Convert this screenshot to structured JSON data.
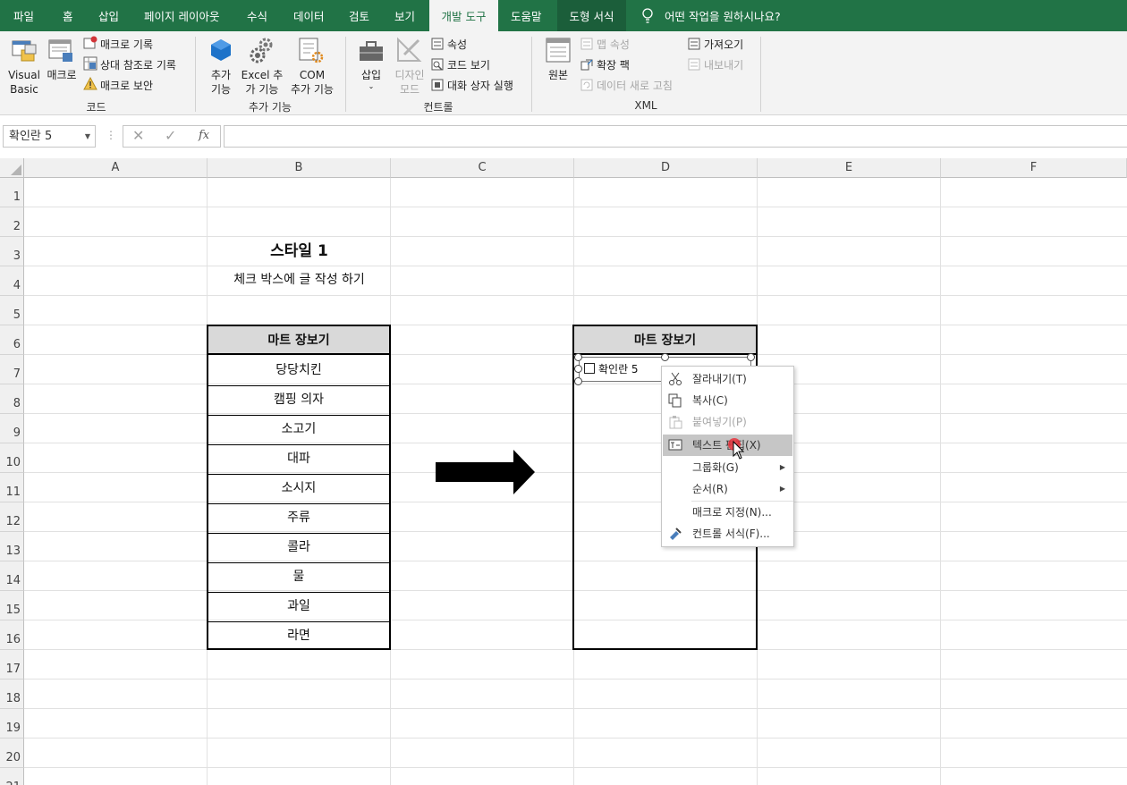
{
  "tabs": [
    "파일",
    "홈",
    "삽입",
    "페이지 레이아웃",
    "수식",
    "데이터",
    "검토",
    "보기",
    "개발 도구",
    "도움말",
    "도형 서식"
  ],
  "tell_me": "어떤 작업을 원하시나요?",
  "ribbon": {
    "code": {
      "visual_basic": [
        "Visual",
        "Basic"
      ],
      "macros": "매크로",
      "record_macro": "매크로 기록",
      "relative_ref": "상대 참조로 기록",
      "macro_security": "매크로 보안",
      "group_label": "코드"
    },
    "addins": {
      "addins": [
        "추가",
        "기능"
      ],
      "excel_addins": [
        "Excel 추",
        "가 기능"
      ],
      "com_addins": [
        "COM",
        "추가 기능"
      ],
      "group_label": "추가 기능"
    },
    "controls": {
      "insert": "삽입",
      "design_mode": [
        "디자인",
        "모드"
      ],
      "properties": "속성",
      "view_code": "코드 보기",
      "run_dialog": "대화 상자 실행",
      "group_label": "컨트롤"
    },
    "xml": {
      "source": "원본",
      "map_properties": "맵 속성",
      "expansion_packs": "확장 팩",
      "refresh_data": "데이터 새로 고침",
      "import": "가져오기",
      "export": "내보내기",
      "group_label": "XML"
    }
  },
  "formula_bar": {
    "name_box": "확인란 5",
    "fx": "fx",
    "value": ""
  },
  "columns": [
    "A",
    "B",
    "C",
    "D",
    "E",
    "F"
  ],
  "rows": [
    "1",
    "2",
    "3",
    "4",
    "5",
    "6",
    "7",
    "8",
    "9",
    "10",
    "11",
    "12",
    "13",
    "14",
    "15",
    "16",
    "17",
    "18",
    "19",
    "20",
    "21"
  ],
  "sheet": {
    "title": "스타일 1",
    "subtitle": "체크 박스에 글 작성 하기",
    "table_header": "마트 장보기",
    "items": [
      "당당치킨",
      "캠핑 의자",
      "소고기",
      "대파",
      "소시지",
      "주류",
      "콜라",
      "물",
      "과일",
      "라면"
    ],
    "right_header": "마트 장보기",
    "checkbox_label": "확인란 5"
  },
  "context_menu": [
    {
      "label": "잘라내기(T)",
      "icon": "scissors-icon",
      "disabled": false
    },
    {
      "label": "복사(C)",
      "icon": "copy-icon",
      "disabled": false
    },
    {
      "label": "붙여넣기(P)",
      "icon": "paste-icon",
      "disabled": true
    },
    {
      "label": "텍스트 편집(X)",
      "icon": "edit-text-icon",
      "disabled": false,
      "highlighted": true
    },
    {
      "label": "그룹화(G)",
      "submenu": true
    },
    {
      "label": "순서(R)",
      "submenu": true
    },
    {
      "label": "매크로 지정(N)...",
      "icon": ""
    },
    {
      "label": "컨트롤 서식(F)...",
      "icon": "format-control-icon"
    }
  ],
  "colors": {
    "excel_green": "#217346",
    "header_fill": "#d9d9d9",
    "cursor_marker": "#e8323c"
  }
}
